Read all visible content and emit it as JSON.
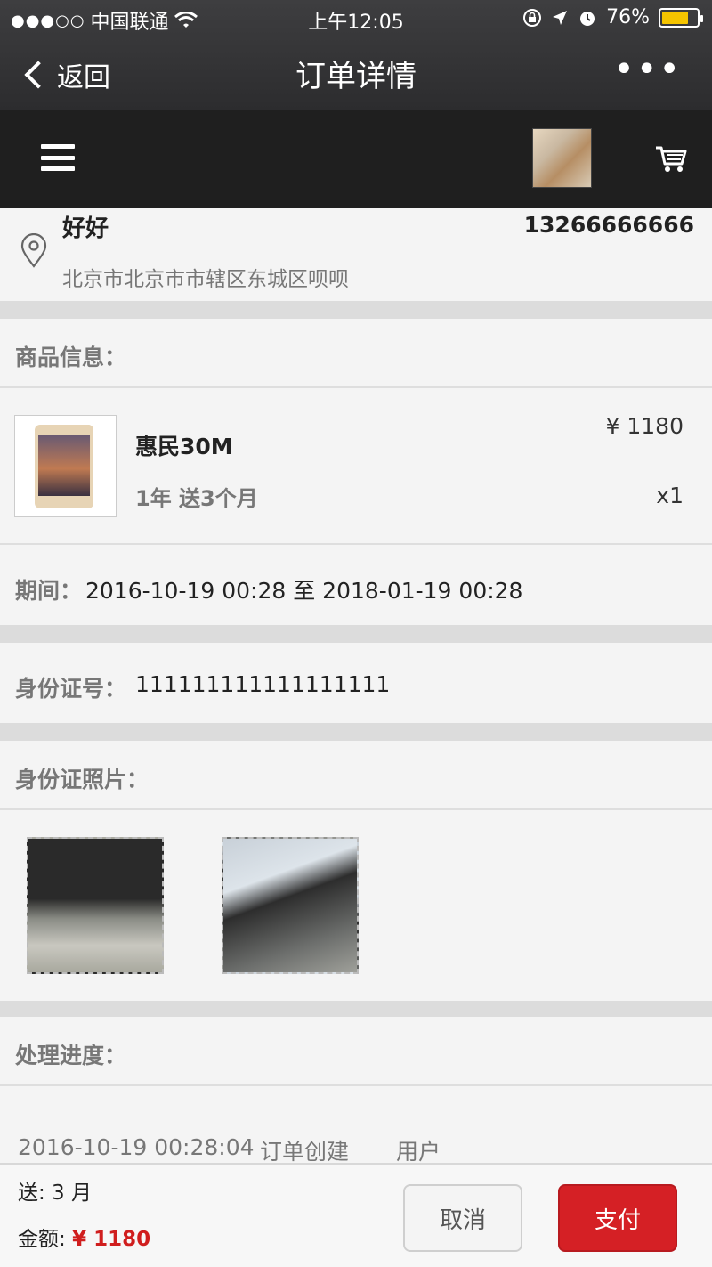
{
  "status": {
    "carrier": "中国联通",
    "time": "上午12:05",
    "battery": "76%",
    "battery_level": 0.76
  },
  "nav": {
    "back_label": "返回",
    "title": "订单详情",
    "more_label": "•••"
  },
  "address": {
    "name": "好好",
    "phone": "13266666666",
    "detail": "北京市北京市市辖区东城区呗呗"
  },
  "product_section": {
    "label": "商品信息："
  },
  "product": {
    "name": "惠民30M",
    "spec": "1年 送3个月",
    "price": "¥ 1180",
    "quantity": "x1"
  },
  "period": {
    "label": "期间：",
    "value": "2016-10-19 00:28 至 2018-01-19 00:28"
  },
  "id_number": {
    "label": "身份证号：",
    "value": "111111111111111111"
  },
  "id_photos": {
    "label": "身份证照片："
  },
  "progress": {
    "label": "处理进度：",
    "entries": [
      {
        "time": "2016-10-19 00:28:04",
        "event": "订单创建",
        "actor": "用户"
      }
    ]
  },
  "footer": {
    "gift": "送: 3 月",
    "amount_label": "金额:",
    "amount_value": "¥ 1180",
    "cancel_label": "取消",
    "pay_label": "支付"
  },
  "colors": {
    "accent_red": "#d52025",
    "battery_yellow": "#f5c400"
  }
}
